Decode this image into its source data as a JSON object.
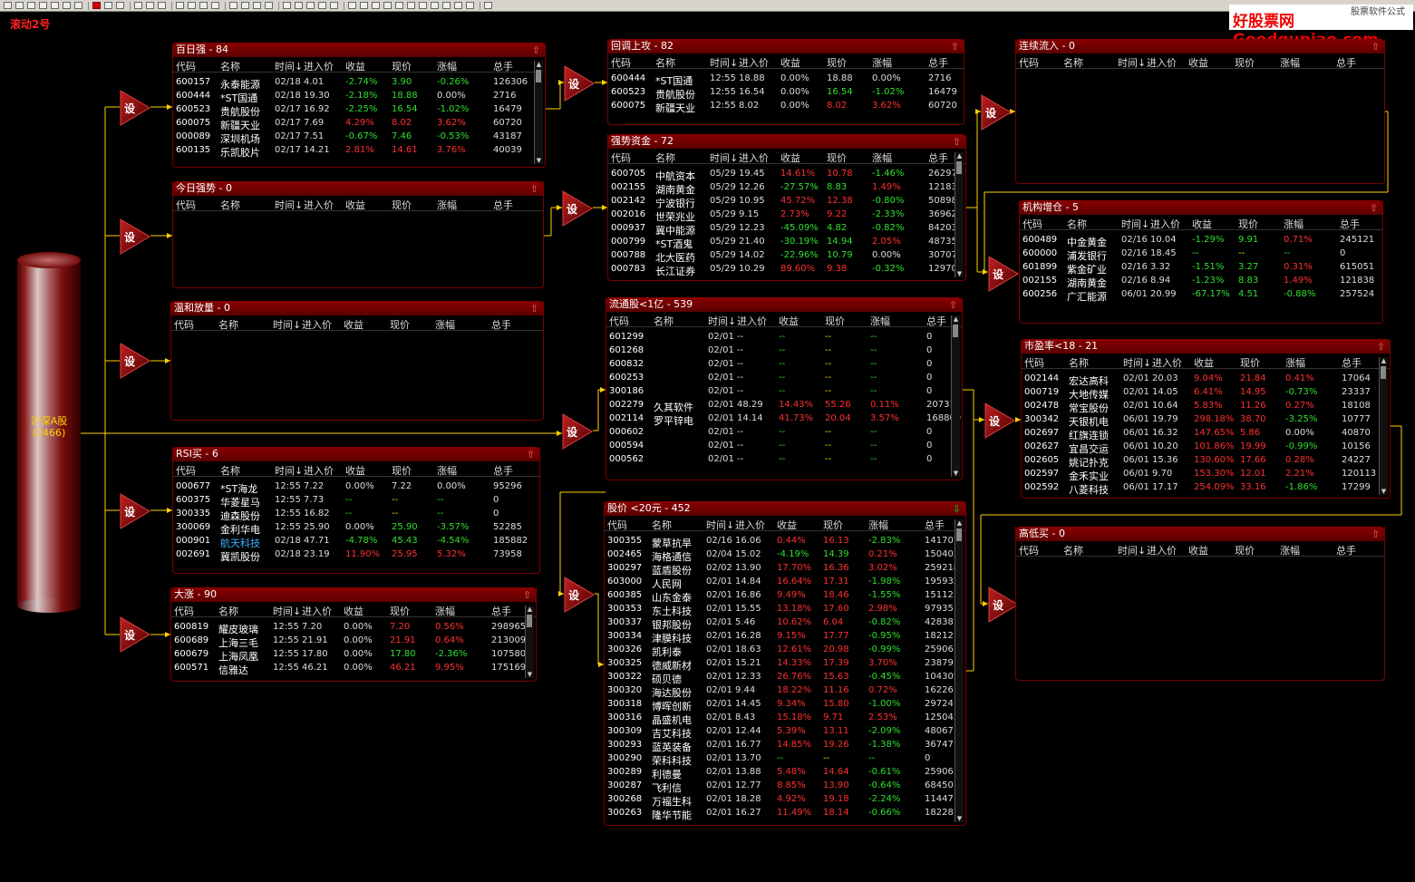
{
  "app_title": "滚动2号",
  "watermark": {
    "site": "好股票网Goodgupiao.com",
    "small": "股票软件公式"
  },
  "source": {
    "label": "沪深A股",
    "count": "(2466)"
  },
  "setting_label": "设",
  "columns": [
    "代码",
    "名称",
    "时间↓",
    "进入价",
    "收益",
    "现价",
    "涨幅",
    "总手"
  ],
  "panels": {
    "bairiqiang": {
      "title": "百日强 - 84",
      "rows": [
        [
          "600157",
          "永泰能源",
          "02/18",
          "4.01",
          "-2.74%",
          "3.90",
          "-0.26%",
          "126306"
        ],
        [
          "600444",
          "*ST国通",
          "02/18",
          "19.30",
          "-2.18%",
          "18.88",
          "0.00%",
          "2716"
        ],
        [
          "600523",
          "贵航股份",
          "02/17",
          "16.92",
          "-2.25%",
          "16.54",
          "-1.02%",
          "16479"
        ],
        [
          "600075",
          "新疆天业",
          "02/17",
          "7.69",
          "4.29%",
          "8.02",
          "3.62%",
          "60720"
        ],
        [
          "000089",
          "深圳机场",
          "02/17",
          "7.51",
          "-0.67%",
          "7.46",
          "-0.53%",
          "43187"
        ],
        [
          "600135",
          "乐凯胶片",
          "02/17",
          "14.21",
          "2.81%",
          "14.61",
          "3.76%",
          "40039"
        ]
      ]
    },
    "jinriqiangshi": {
      "title": "今日强势 - 0",
      "rows": []
    },
    "wenhefangliang": {
      "title": "温和放量 - 0",
      "rows": []
    },
    "rsimai": {
      "title": "RSI买 - 6",
      "rows": [
        [
          "000677",
          "*ST海龙",
          "12:55",
          "7.22",
          "0.00%",
          "7.22",
          "0.00%",
          "95296"
        ],
        [
          "600375",
          "华菱星马",
          "12:55",
          "7.73",
          "--",
          "--",
          "--",
          "0"
        ],
        [
          "300335",
          "迪森股份",
          "12:55",
          "16.82",
          "--",
          "--",
          "--",
          "0"
        ],
        [
          "300069",
          "金利华电",
          "12:55",
          "25.90",
          "0.00%",
          "25.90",
          "-3.57%",
          "52285"
        ],
        [
          "000901",
          "航天科技",
          "02/18",
          "47.71",
          "-4.78%",
          "45.43",
          "-4.54%",
          "185882"
        ],
        [
          "002691",
          "冀凯股份",
          "02/18",
          "23.19",
          "11.90%",
          "25.95",
          "5.32%",
          "73958"
        ]
      ]
    },
    "dazhang": {
      "title": "大涨 - 90",
      "rows": [
        [
          "600819",
          "耀皮玻璃",
          "12:55",
          "7.20",
          "0.00%",
          "7.20",
          "0.56%",
          "298965"
        ],
        [
          "600689",
          "上海三毛",
          "12:55",
          "21.91",
          "0.00%",
          "21.91",
          "0.64%",
          "213009"
        ],
        [
          "600679",
          "上海凤凰",
          "12:55",
          "17.80",
          "0.00%",
          "17.80",
          "-2.36%",
          "107580"
        ],
        [
          "600571",
          "信雅达",
          "12:55",
          "46.21",
          "0.00%",
          "46.21",
          "9.95%",
          "175169"
        ]
      ]
    },
    "huitiaoshanggong": {
      "title": "回调上攻 - 82",
      "rows": [
        [
          "600444",
          "*ST国通",
          "12:55",
          "18.88",
          "0.00%",
          "18.88",
          "0.00%",
          "2716"
        ],
        [
          "600523",
          "贵航股份",
          "12:55",
          "16.54",
          "0.00%",
          "16.54",
          "-1.02%",
          "16479"
        ],
        [
          "600075",
          "新疆天业",
          "12:55",
          "8.02",
          "0.00%",
          "8.02",
          "3.62%",
          "60720"
        ]
      ]
    },
    "qiangshizijin": {
      "title": "强势资金 - 72",
      "rows": [
        [
          "600705",
          "中航资本",
          "05/29",
          "19.45",
          "14.61%",
          "10.78",
          "-1.46%",
          "262975"
        ],
        [
          "002155",
          "湖南黄金",
          "05/29",
          "12.26",
          "-27.57%",
          "8.83",
          "1.49%",
          "121838"
        ],
        [
          "002142",
          "宁波银行",
          "05/29",
          "10.95",
          "45.72%",
          "12.38",
          "-0.80%",
          "50898"
        ],
        [
          "002016",
          "世荣兆业",
          "05/29",
          "9.15",
          "2.73%",
          "9.22",
          "-2.33%",
          "36962"
        ],
        [
          "000937",
          "冀中能源",
          "05/29",
          "12.23",
          "-45.09%",
          "4.82",
          "-0.82%",
          "84203"
        ],
        [
          "000799",
          "*ST酒鬼",
          "05/29",
          "21.40",
          "-30.19%",
          "14.94",
          "2.05%",
          "48735"
        ],
        [
          "000788",
          "北大医药",
          "05/29",
          "14.02",
          "-22.96%",
          "10.79",
          "0.00%",
          "30707"
        ],
        [
          "000783",
          "长江证券",
          "05/29",
          "10.29",
          "89.60%",
          "9.38",
          "-0.32%",
          "129709"
        ]
      ]
    },
    "liutonggu": {
      "title": "流通股<1亿 - 539",
      "rows": [
        [
          "601299",
          "",
          "02/01",
          "--",
          "--",
          "--",
          "--",
          "0"
        ],
        [
          "601268",
          "",
          "02/01",
          "--",
          "--",
          "--",
          "--",
          "0"
        ],
        [
          "600832",
          "",
          "02/01",
          "--",
          "--",
          "--",
          "--",
          "0"
        ],
        [
          "600253",
          "",
          "02/01",
          "--",
          "--",
          "--",
          "--",
          "0"
        ],
        [
          "300186",
          "",
          "02/01",
          "--",
          "--",
          "--",
          "--",
          "0"
        ],
        [
          "002279",
          "久其软件",
          "02/01",
          "48.29",
          "14.43%",
          "55.26",
          "0.11%",
          "20731"
        ],
        [
          "002114",
          "罗平锌电",
          "02/01",
          "14.14",
          "41.73%",
          "20.04",
          "3.57%",
          "168800"
        ],
        [
          "000602",
          "",
          "02/01",
          "--",
          "--",
          "--",
          "--",
          "0"
        ],
        [
          "000594",
          "",
          "02/01",
          "--",
          "--",
          "--",
          "--",
          "0"
        ],
        [
          "000562",
          "",
          "02/01",
          "--",
          "--",
          "--",
          "--",
          "0"
        ]
      ]
    },
    "gujia": {
      "title": "股价 <20元 - 452",
      "rows": [
        [
          "300355",
          "蒙草抗旱",
          "02/16",
          "16.06",
          "0.44%",
          "16.13",
          "-2.83%",
          "141707"
        ],
        [
          "002465",
          "海格通信",
          "02/04",
          "15.02",
          "-4.19%",
          "14.39",
          "0.21%",
          "150403"
        ],
        [
          "300297",
          "蓝盾股份",
          "02/02",
          "13.90",
          "17.70%",
          "16.36",
          "3.02%",
          "259218"
        ],
        [
          "603000",
          "人民网",
          "02/01",
          "14.84",
          "16.64%",
          "17.31",
          "-1.98%",
          "195932"
        ],
        [
          "600385",
          "山东金泰",
          "02/01",
          "16.86",
          "9.49%",
          "18.46",
          "-1.55%",
          "15112"
        ],
        [
          "300353",
          "东土科技",
          "02/01",
          "15.55",
          "13.18%",
          "17.60",
          "2.98%",
          "97935"
        ],
        [
          "300337",
          "银邦股份",
          "02/01",
          "5.46",
          "10.62%",
          "6.04",
          "-0.82%",
          "42838"
        ],
        [
          "300334",
          "津膜科技",
          "02/01",
          "16.28",
          "9.15%",
          "17.77",
          "-0.95%",
          "18212"
        ],
        [
          "300326",
          "凯利泰",
          "02/01",
          "18.63",
          "12.61%",
          "20.98",
          "-0.99%",
          "25906"
        ],
        [
          "300325",
          "德威新材",
          "02/01",
          "15.21",
          "14.33%",
          "17.39",
          "3.70%",
          "23879"
        ],
        [
          "300322",
          "硕贝德",
          "02/01",
          "12.33",
          "26.76%",
          "15.63",
          "-0.45%",
          "104305"
        ],
        [
          "300320",
          "海达股份",
          "02/01",
          "9.44",
          "18.22%",
          "11.16",
          "0.72%",
          "16226"
        ],
        [
          "300318",
          "博晖创新",
          "02/01",
          "14.45",
          "9.34%",
          "15.80",
          "-1.00%",
          "29724"
        ],
        [
          "300316",
          "晶盛机电",
          "02/01",
          "8.43",
          "15.18%",
          "9.71",
          "2.53%",
          "125043"
        ],
        [
          "300309",
          "吉艾科技",
          "02/01",
          "12.44",
          "5.39%",
          "13.11",
          "-2.09%",
          "48067"
        ],
        [
          "300293",
          "蓝英装备",
          "02/01",
          "16.77",
          "14.85%",
          "19.26",
          "-1.38%",
          "36747"
        ],
        [
          "300290",
          "荣科科技",
          "02/01",
          "13.70",
          "--",
          "--",
          "--",
          "0"
        ],
        [
          "300289",
          "利德曼",
          "02/01",
          "13.88",
          "5.48%",
          "14.64",
          "-0.61%",
          "25906"
        ],
        [
          "300287",
          "飞利信",
          "02/01",
          "12.77",
          "8.85%",
          "13.90",
          "-0.64%",
          "68450"
        ],
        [
          "300268",
          "万福生科",
          "02/01",
          "18.28",
          "4.92%",
          "19.18",
          "-2.24%",
          "11447"
        ],
        [
          "300263",
          "隆华节能",
          "02/01",
          "16.27",
          "11.49%",
          "18.14",
          "-0.66%",
          "18228"
        ]
      ]
    },
    "lianxuliuru": {
      "title": "连续流入 - 0",
      "rows": []
    },
    "jigouzengcang": {
      "title": "机构增仓 - 5",
      "rows": [
        [
          "600489",
          "中金黄金",
          "02/16",
          "10.04",
          "-1.29%",
          "9.91",
          "0.71%",
          "245121"
        ],
        [
          "600000",
          "浦发银行",
          "02/16",
          "18.45",
          "--",
          "--",
          "--",
          "0"
        ],
        [
          "601899",
          "紫金矿业",
          "02/16",
          "3.32",
          "-1.51%",
          "3.27",
          "0.31%",
          "615051"
        ],
        [
          "002155",
          "湖南黄金",
          "02/16",
          "8.94",
          "-1.23%",
          "8.83",
          "1.49%",
          "121838"
        ],
        [
          "600256",
          "广汇能源",
          "06/01",
          "20.99",
          "-67.17%",
          "4.51",
          "-0.88%",
          "257524"
        ]
      ]
    },
    "shiyinglv": {
      "title": "市盈率<18 - 21",
      "rows": [
        [
          "002144",
          "宏达高科",
          "02/01",
          "20.03",
          "9.04%",
          "21.84",
          "0.41%",
          "17064"
        ],
        [
          "000719",
          "大地传媒",
          "02/01",
          "14.05",
          "6.41%",
          "14.95",
          "-0.73%",
          "23337"
        ],
        [
          "002478",
          "常宝股份",
          "02/01",
          "10.64",
          "5.83%",
          "11.26",
          "0.27%",
          "18108"
        ],
        [
          "300342",
          "天银机电",
          "06/01",
          "19.79",
          "298.18%",
          "38.70",
          "-3.25%",
          "10777"
        ],
        [
          "002697",
          "红旗连锁",
          "06/01",
          "16.32",
          "147.65%",
          "5.86",
          "0.00%",
          "40870"
        ],
        [
          "002627",
          "宜昌交运",
          "06/01",
          "10.20",
          "101.86%",
          "19.99",
          "-0.99%",
          "10156"
        ],
        [
          "002605",
          "姚记扑克",
          "06/01",
          "15.36",
          "130.60%",
          "17.66",
          "0.28%",
          "24227"
        ],
        [
          "002597",
          "金禾实业",
          "06/01",
          "9.70",
          "153.30%",
          "12.01",
          "2.21%",
          "120113"
        ],
        [
          "002592",
          "八菱科技",
          "06/01",
          "17.17",
          "254.09%",
          "33.16",
          "-1.86%",
          "17299"
        ]
      ]
    },
    "gaodimai": {
      "title": "高低买 - 0",
      "rows": []
    }
  },
  "colors": {
    "up": "#ff3030",
    "down": "#30e030",
    "neutral": "#dddddd",
    "header": "#8a0000",
    "line": "#ffd200"
  }
}
